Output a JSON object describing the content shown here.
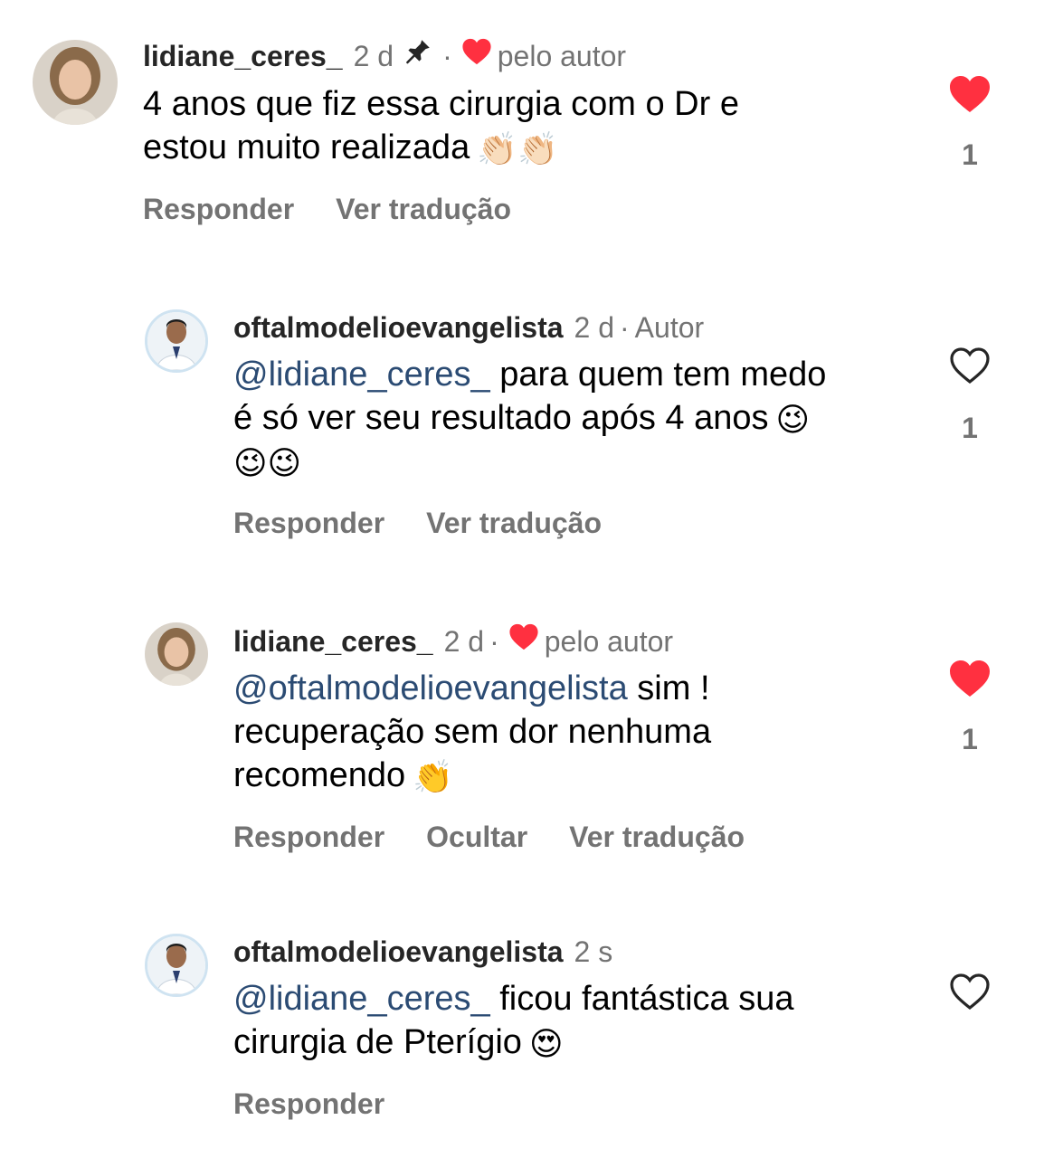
{
  "comments": [
    {
      "username": "lidiane_ceres_",
      "time": "2 d",
      "pinned": true,
      "liked_by_author": "pelo autor",
      "text": "4 anos que fiz essa cirurgia com o Dr e",
      "text_line2": "estou muito realizada",
      "emoji": "👏🏻👏🏻",
      "actions": [
        "Responder",
        "Ver tradução"
      ],
      "likes": "1",
      "liked": true
    },
    {
      "username": "oftalmodelioevangelista",
      "time": "2 d",
      "author_label": "Autor",
      "mention": "@lidiane_ceres_",
      "text": "para quem tem medo",
      "text_line2": "é só ver seu resultado após 4 anos",
      "emoji_inline": "😉",
      "emoji_line3": "😉😉",
      "actions": [
        "Responder",
        "Ver tradução"
      ],
      "likes": "1",
      "liked": false
    },
    {
      "username": "lidiane_ceres_",
      "time": "2 d",
      "liked_by_author": "pelo autor",
      "mention": "@oftalmodelioevangelista",
      "text": "sim !",
      "text_line2": "recuperação sem dor nenhuma",
      "text_line3": "recomendo",
      "emoji": "👏",
      "actions": [
        "Responder",
        "Ocultar",
        "Ver tradução"
      ],
      "likes": "1",
      "liked": true
    },
    {
      "username": "oftalmodelioevangelista",
      "time": "2 s",
      "mention": "@lidiane_ceres_",
      "text": "ficou fantástica sua",
      "text_line2": "cirurgia de Pterígio",
      "emoji": "😍",
      "actions": [
        "Responder"
      ],
      "liked": false
    }
  ],
  "colors": {
    "like_red": "#ff3040",
    "muted": "#737373",
    "mention": "#2b4b73"
  }
}
